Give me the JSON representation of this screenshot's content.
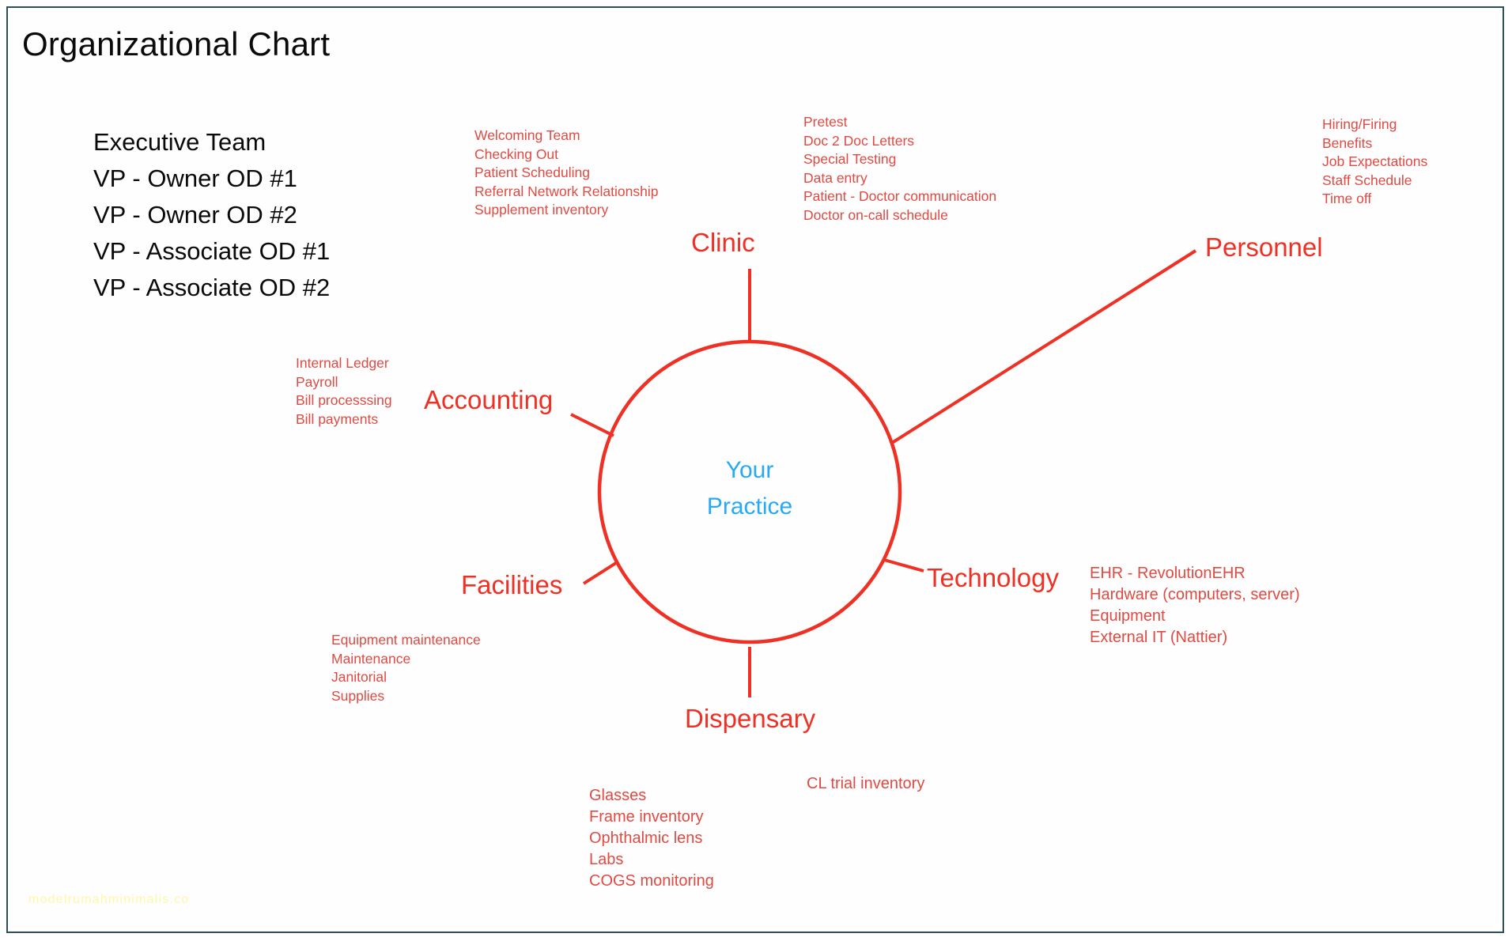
{
  "page": {
    "title": "Organizational Chart",
    "watermark": "modelrumahminimalis.co",
    "accent_red": "#ee3124",
    "detail_red": "#e04a42",
    "hub_blue": "#29a9f2",
    "border_color": "#2e4f58",
    "text_black": "#0a0a0a"
  },
  "executive": {
    "heading": "Executive Team",
    "lines": [
      "VP - Owner OD #1",
      "VP - Owner OD #2",
      "VP - Associate OD #1",
      "VP - Associate OD #2"
    ]
  },
  "hub": {
    "line1": "Your",
    "line2": "Practice"
  },
  "branches": [
    {
      "id": "clinic",
      "label": "Clinic"
    },
    {
      "id": "personnel",
      "label": "Personnel"
    },
    {
      "id": "accounting",
      "label": "Accounting"
    },
    {
      "id": "facilities",
      "label": "Facilities"
    },
    {
      "id": "technology",
      "label": "Technology"
    },
    {
      "id": "dispensary",
      "label": "Dispensary"
    }
  ],
  "details": {
    "clinic": [
      "Welcoming Team",
      "Checking Out",
      "Patient Scheduling",
      "Referral Network Relationship",
      "Supplement inventory"
    ],
    "pretest": [
      "Pretest",
      "Doc 2 Doc Letters",
      "Special Testing",
      "Data entry",
      "Patient - Doctor communication",
      "Doctor on-call schedule"
    ],
    "personnel": [
      "Hiring/Firing",
      "Benefits",
      "Job Expectations",
      "Staff Schedule",
      "Time off"
    ],
    "accounting": [
      "Internal Ledger",
      "Payroll",
      "Bill processsing",
      "Bill payments"
    ],
    "facilities": [
      "Equipment maintenance",
      "Maintenance",
      "Janitorial",
      "Supplies"
    ],
    "technology": [
      "EHR - RevolutionEHR",
      "Hardware (computers, server)",
      "Equipment",
      "External IT (Nattier)"
    ],
    "dispensary": [
      "Glasses",
      "Frame inventory",
      "Ophthalmic lens",
      "Labs",
      "COGS monitoring"
    ],
    "contact_lens": [
      "CL trial inventory"
    ]
  },
  "chart_data": {
    "type": "diagram",
    "diagram_kind": "hub-and-spoke organizational chart",
    "title": "Organizational Chart",
    "center": "Your Practice",
    "spokes": [
      {
        "name": "Clinic",
        "items": [
          "Welcoming Team",
          "Checking Out",
          "Patient Scheduling",
          "Referral Network Relationship",
          "Supplement inventory",
          "Pretest",
          "Doc 2 Doc Letters",
          "Special Testing",
          "Data entry",
          "Patient - Doctor communication",
          "Doctor on-call schedule"
        ]
      },
      {
        "name": "Personnel",
        "items": [
          "Hiring/Firing",
          "Benefits",
          "Job Expectations",
          "Staff Schedule",
          "Time off"
        ]
      },
      {
        "name": "Accounting",
        "items": [
          "Internal Ledger",
          "Payroll",
          "Bill processsing",
          "Bill payments"
        ]
      },
      {
        "name": "Facilities",
        "items": [
          "Equipment maintenance",
          "Maintenance",
          "Janitorial",
          "Supplies"
        ]
      },
      {
        "name": "Technology",
        "items": [
          "EHR - RevolutionEHR",
          "Hardware (computers, server)",
          "Equipment",
          "External IT (Nattier)"
        ]
      },
      {
        "name": "Dispensary",
        "items": [
          "Glasses",
          "Frame inventory",
          "Ophthalmic lens",
          "Labs",
          "COGS monitoring",
          "CL trial inventory"
        ]
      }
    ],
    "side_panel": {
      "heading": "Executive Team",
      "items": [
        "VP - Owner OD #1",
        "VP - Owner OD #2",
        "VP - Associate OD #1",
        "VP - Associate OD #2"
      ]
    }
  }
}
